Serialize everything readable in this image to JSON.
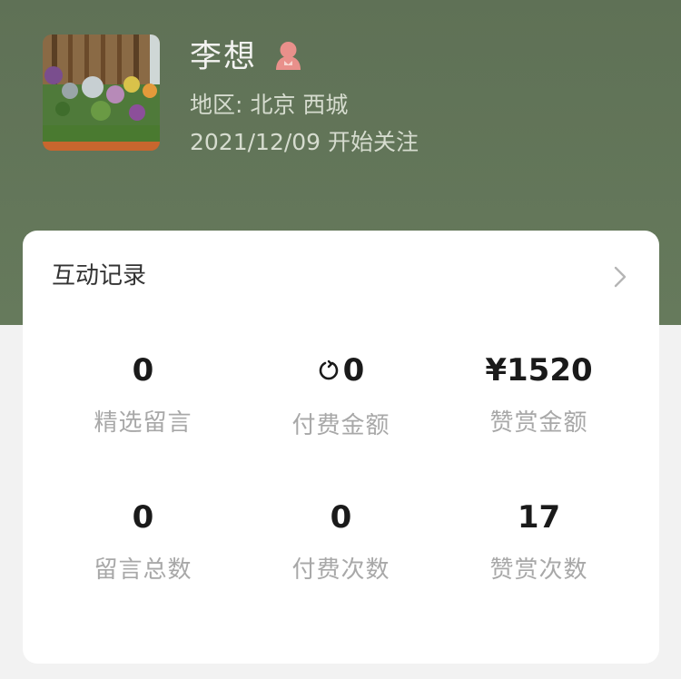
{
  "profile": {
    "name": "李想",
    "gender_icon": "female-icon",
    "region_label": "地区:",
    "region_value": "北京 西城",
    "follow_date": "2021/12/09 开始关注"
  },
  "card": {
    "title": "互动记录",
    "stats": [
      {
        "value": "0",
        "label": "精选留言"
      },
      {
        "value": "0",
        "label": "付费金额",
        "icon": "coin-icon"
      },
      {
        "value": "¥1520",
        "label": "赞赏金额"
      },
      {
        "value": "0",
        "label": "留言总数"
      },
      {
        "value": "0",
        "label": "付费次数"
      },
      {
        "value": "17",
        "label": "赞赏次数"
      }
    ]
  },
  "colors": {
    "header_bg": "#627457",
    "card_bg": "#ffffff",
    "page_bg": "#f2f2f2",
    "gender_icon": "#e9908b"
  }
}
